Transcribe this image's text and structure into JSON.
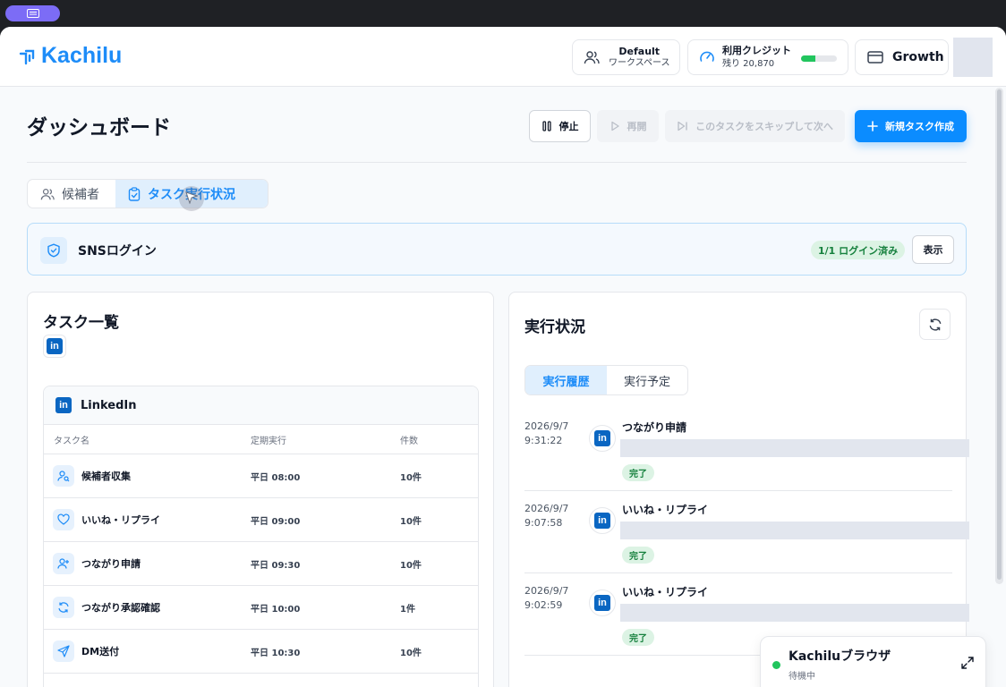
{
  "header": {
    "logo_text": "Kachilu",
    "workspace": {
      "title": "Default",
      "subtitle": "ワークスペース"
    },
    "credit": {
      "title": "利用クレジット",
      "remaining": "残り 20,870",
      "fill_fraction": 0.4
    },
    "plan_label": "Growth"
  },
  "page": {
    "title": "ダッシュボード",
    "buttons": {
      "stop": "停止",
      "resume": "再開",
      "skip": "このタスクをスキップして次へ",
      "new_task": "新規タスク作成"
    },
    "tabs": [
      {
        "label": "候補者",
        "active": false
      },
      {
        "label": "タスク実行状況",
        "active": true
      }
    ]
  },
  "sns": {
    "title": "SNSログイン",
    "status": "1/1 ログイン済み",
    "show_button": "表示"
  },
  "task_list": {
    "title": "タスク一覧",
    "platform_label": "LinkedIn",
    "columns": [
      "タスク名",
      "定期実行",
      "件数"
    ],
    "rows": [
      {
        "icon": "user-search-icon",
        "name": "候補者収集",
        "schedule": "平日 08:00",
        "count": "10件"
      },
      {
        "icon": "heart-icon",
        "name": "いいね・リプライ",
        "schedule": "平日 09:00",
        "count": "10件"
      },
      {
        "icon": "user-plus-icon",
        "name": "つながり申請",
        "schedule": "平日 09:30",
        "count": "10件"
      },
      {
        "icon": "refresh-icon",
        "name": "つながり承認確認",
        "schedule": "平日 10:00",
        "count": "1件"
      },
      {
        "icon": "send-icon",
        "name": "DM送付",
        "schedule": "平日 10:30",
        "count": "10件"
      }
    ]
  },
  "execution": {
    "title": "実行状況",
    "subtabs": [
      "実行履歴",
      "実行予定"
    ],
    "history": [
      {
        "date": "2026/9/7",
        "time": "9:31:22",
        "title": "つながり申請",
        "status": "完了"
      },
      {
        "date": "2026/9/7",
        "time": "9:07:58",
        "title": "いいね・リプライ",
        "status": "完了"
      },
      {
        "date": "2026/9/7",
        "time": "9:02:59",
        "title": "いいね・リプライ",
        "status": "完了"
      }
    ]
  },
  "browser_card": {
    "title": "Kachiluブラウザ",
    "status": "待機中"
  },
  "colors": {
    "accent": "#1d8cf8",
    "primary_button": "#0b8cff",
    "success_bg": "#dcf3e4",
    "success_text": "#15803d",
    "linkedin": "#0a66c2"
  }
}
